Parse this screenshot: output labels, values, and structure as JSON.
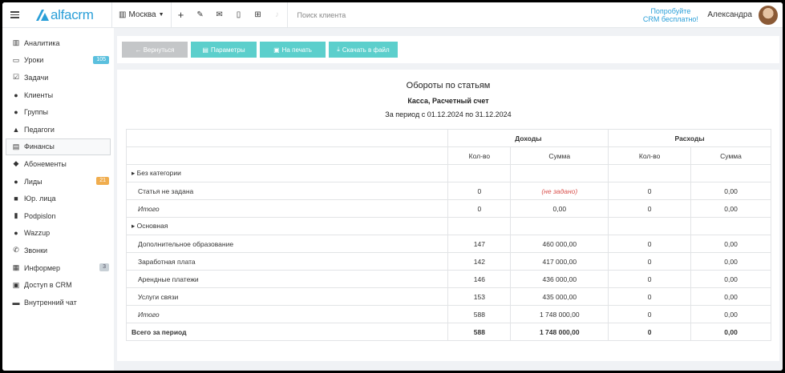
{
  "header": {
    "logo": "alfacrm",
    "branch": "Москва",
    "search_placeholder": "Поиск клиента",
    "try_line1": "Попробуйте",
    "try_line2": "CRM бесплатно!",
    "user_name": "Александра"
  },
  "sidebar": {
    "items": [
      {
        "label": "Аналитика",
        "icon": "analytics-icon",
        "glyph": "▥"
      },
      {
        "label": "Уроки",
        "icon": "calendar-icon",
        "glyph": "▭",
        "badge": "105",
        "badge_color": "#5bc0de"
      },
      {
        "label": "Задачи",
        "icon": "tasks-icon",
        "glyph": "☑"
      },
      {
        "label": "Клиенты",
        "icon": "user-icon",
        "glyph": "●"
      },
      {
        "label": "Группы",
        "icon": "users-icon",
        "glyph": "●"
      },
      {
        "label": "Педагоги",
        "icon": "graduation-cap-icon",
        "glyph": "▲"
      },
      {
        "label": "Финансы",
        "icon": "money-icon",
        "glyph": "▤",
        "active": true
      },
      {
        "label": "Абонементы",
        "icon": "tag-icon",
        "glyph": "◆"
      },
      {
        "label": "Лиды",
        "icon": "lead-icon",
        "glyph": "●",
        "badge": "21",
        "badge_color": "#f0ad4e"
      },
      {
        "label": "Юр. лица",
        "icon": "briefcase-icon",
        "glyph": "■"
      },
      {
        "label": "Podpislon",
        "icon": "document-icon",
        "glyph": "▮"
      },
      {
        "label": "Wazzup",
        "icon": "whatsapp-icon",
        "glyph": "●"
      },
      {
        "label": "Звонки",
        "icon": "phone-icon",
        "glyph": "✆"
      },
      {
        "label": "Информер",
        "icon": "newspaper-icon",
        "glyph": "▦",
        "badge": "3",
        "badge_color": "#c8d0d6"
      },
      {
        "label": "Доступ в CRM",
        "icon": "lock-icon",
        "glyph": "▣"
      },
      {
        "label": "Внутренний чат",
        "icon": "chat-icon",
        "glyph": "▬"
      }
    ]
  },
  "toolbar": {
    "back": "← Вернуться",
    "params": "Параметры",
    "print": "На печать",
    "download": "Скачать в файл"
  },
  "report": {
    "title": "Обороты по статьям",
    "subtitle": "Касса, Расчетный счет",
    "period": "За период с 01.12.2024 по 31.12.2024",
    "income_header": "Доходы",
    "expense_header": "Расходы",
    "col_count": "Кол-во",
    "col_sum": "Сумма",
    "rows": [
      {
        "type": "group",
        "label": "▸ Без категории"
      },
      {
        "type": "item",
        "label": "Статья не задана",
        "inc_count": "0",
        "inc_sum": "(не задано)",
        "exp_count": "0",
        "exp_sum": "0,00",
        "inc_sum_red": true
      },
      {
        "type": "total",
        "label": "Итого",
        "inc_count": "0",
        "inc_sum": "0,00",
        "exp_count": "0",
        "exp_sum": "0,00"
      },
      {
        "type": "group",
        "label": "▸ Основная"
      },
      {
        "type": "item",
        "label": "Дополнительное образование",
        "inc_count": "147",
        "inc_sum": "460 000,00",
        "exp_count": "0",
        "exp_sum": "0,00"
      },
      {
        "type": "item",
        "label": "Заработная плата",
        "inc_count": "142",
        "inc_sum": "417 000,00",
        "exp_count": "0",
        "exp_sum": "0,00"
      },
      {
        "type": "item",
        "label": "Арендные платежи",
        "inc_count": "146",
        "inc_sum": "436 000,00",
        "exp_count": "0",
        "exp_sum": "0,00"
      },
      {
        "type": "item",
        "label": "Услуги связи",
        "inc_count": "153",
        "inc_sum": "435 000,00",
        "exp_count": "0",
        "exp_sum": "0,00"
      },
      {
        "type": "total",
        "label": "Итого",
        "inc_count": "588",
        "inc_sum": "1 748 000,00",
        "exp_count": "0",
        "exp_sum": "0,00"
      },
      {
        "type": "grand",
        "label": "Всего за период",
        "inc_count": "588",
        "inc_sum": "1 748 000,00",
        "exp_count": "0",
        "exp_sum": "0,00"
      }
    ]
  }
}
